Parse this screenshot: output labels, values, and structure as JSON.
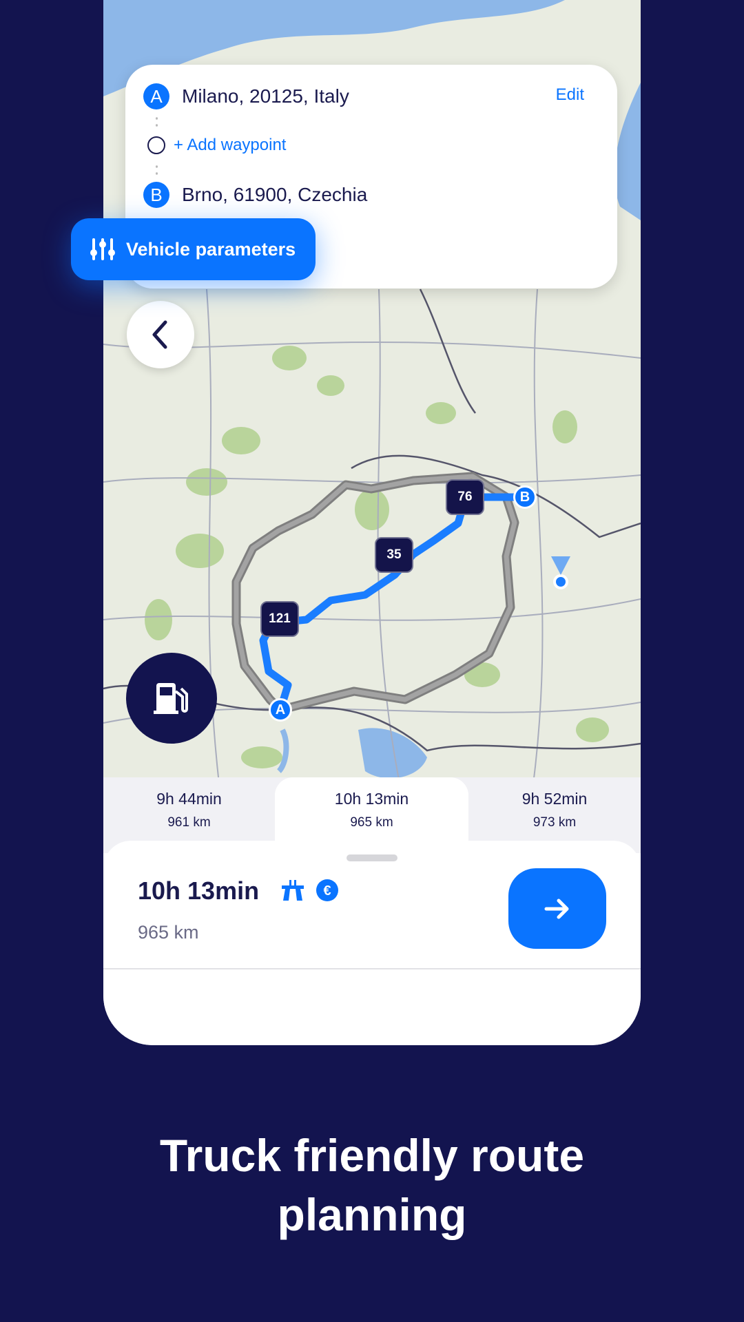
{
  "route": {
    "origin": {
      "pin": "A",
      "label": "Milano, 20125, Italy"
    },
    "waypoint": {
      "label": "+ Add waypoint"
    },
    "destination": {
      "pin": "B",
      "label": "Brno, 61900, Czechia"
    },
    "edit_label": "Edit"
  },
  "vehicle_button": {
    "label": "Vehicle parameters",
    "icon": "sliders-icon"
  },
  "map": {
    "markers": [
      "121",
      "35",
      "76"
    ],
    "start": "A",
    "end": "B",
    "colors": {
      "active_route": "#1a7dff",
      "alt_route": "#8e8e8e",
      "marker": "#14144a"
    }
  },
  "alternatives": [
    {
      "time": "9h 44min",
      "distance": "961 km"
    },
    {
      "time": "10h 13min",
      "distance": "965 km",
      "selected": true
    },
    {
      "time": "9h 52min",
      "distance": "973 km"
    }
  ],
  "summary": {
    "time": "10h 13min",
    "distance": "965 km",
    "icons": [
      "motorway-icon",
      "toll-euro-icon"
    ]
  },
  "caption": {
    "line1": "Truck friendly route",
    "line2": "planning"
  },
  "colors": {
    "accent": "#0a74ff",
    "background": "#13144f",
    "text": "#1a1a4e"
  }
}
